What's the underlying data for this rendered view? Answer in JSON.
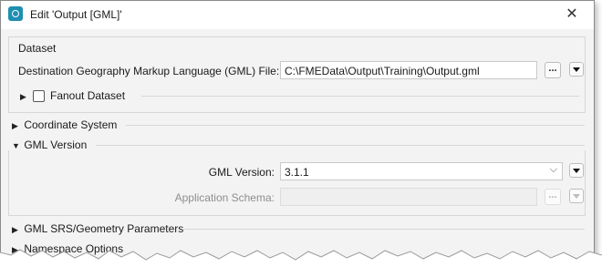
{
  "window": {
    "title": "Edit 'Output [GML]'",
    "close_glyph": "✕",
    "app_icon": "fme-app-icon"
  },
  "dataset": {
    "group_title": "Dataset",
    "destination_label": "Destination Geography Markup Language (GML) File:",
    "destination_value": "C:\\FMEData\\Output\\Training\\Output.gml",
    "browse_label": "...",
    "fanout_label": "Fanout Dataset",
    "fanout_checked": false
  },
  "sections": {
    "coordinate_system": "Coordinate System",
    "gml_version": "GML Version",
    "srs_params": "GML SRS/Geometry Parameters",
    "namespace": "Namespace Options"
  },
  "gml_version": {
    "version_label": "GML Version:",
    "version_value": "3.1.1",
    "schema_label": "Application Schema:",
    "schema_value": "",
    "browse_label": "..."
  },
  "colors": {
    "accent": "#1f8fb0",
    "dialog_bg": "#f3f3f3",
    "disabled_text": "#8e8e8e"
  }
}
